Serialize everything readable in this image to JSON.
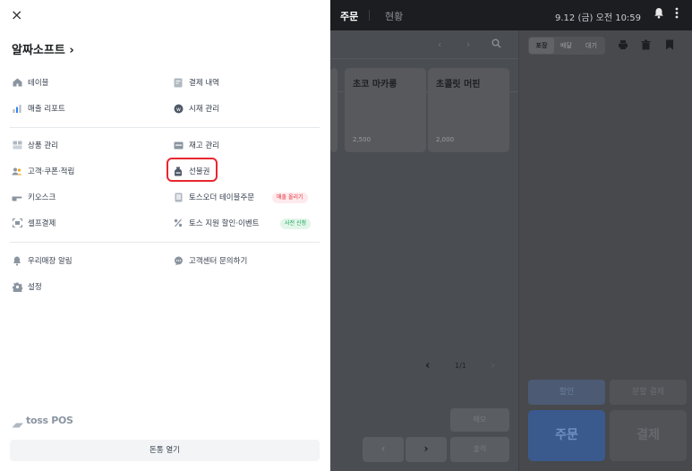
{
  "drawer": {
    "close_icon": "×",
    "store_name": "알짜소프트 ›",
    "items": {
      "table": "테이블",
      "payment_history": "결제 내역",
      "sales_report": "매출 리포트",
      "market_price": "시재 관리",
      "product_mgmt": "상품 관리",
      "inventory": "재고 관리",
      "customer": "고객·쿠폰·적립",
      "gift_card": "선불권",
      "kiosk": "키오스크",
      "toss_order": "토스오더 테이블주문",
      "self_pay": "셀프결제",
      "toss_discount": "토스 지원 할인·이벤트",
      "store_alert": "우리매장 알림",
      "support": "고객센터 문의하기",
      "settings": "설정"
    },
    "badges": {
      "sales_boost": "매출 올리기",
      "pre_apply": "사전 신청"
    },
    "logo_text": "toss POS",
    "cashbox_button": "돈통 열기"
  },
  "topbar": {
    "tab_order": "주문",
    "tab_status": "현황",
    "clock": "9.12 (금) 오전 10:59",
    "bell_icon": "bell-icon",
    "more_icon": "more-icon"
  },
  "menu": {
    "prev_icon": "‹",
    "next_icon": "›",
    "search_icon": "⌕",
    "products": [
      {
        "name": "초코 마카롱",
        "price": "2,500"
      },
      {
        "name": "초콜릿 머핀",
        "price": "2,000"
      }
    ],
    "pager": {
      "prev": "‹",
      "text": "1/1",
      "next": "›"
    },
    "memo_label": "메모",
    "nav_prev": "‹",
    "nav_next": "›",
    "send_label": "출력"
  },
  "order": {
    "types": {
      "takeout": "포장",
      "delivery": "배달",
      "wait": "대기"
    },
    "discount_label": "할인",
    "split_label": "분할 결제",
    "order_label": "주문",
    "pay_label": "결제"
  },
  "colors": {
    "highlight": "#e8262f",
    "badge_red_bg": "#fdeaec",
    "badge_red_text": "#e5323f",
    "badge_green_bg": "#e3f6ea",
    "badge_green_text": "#14a356"
  }
}
